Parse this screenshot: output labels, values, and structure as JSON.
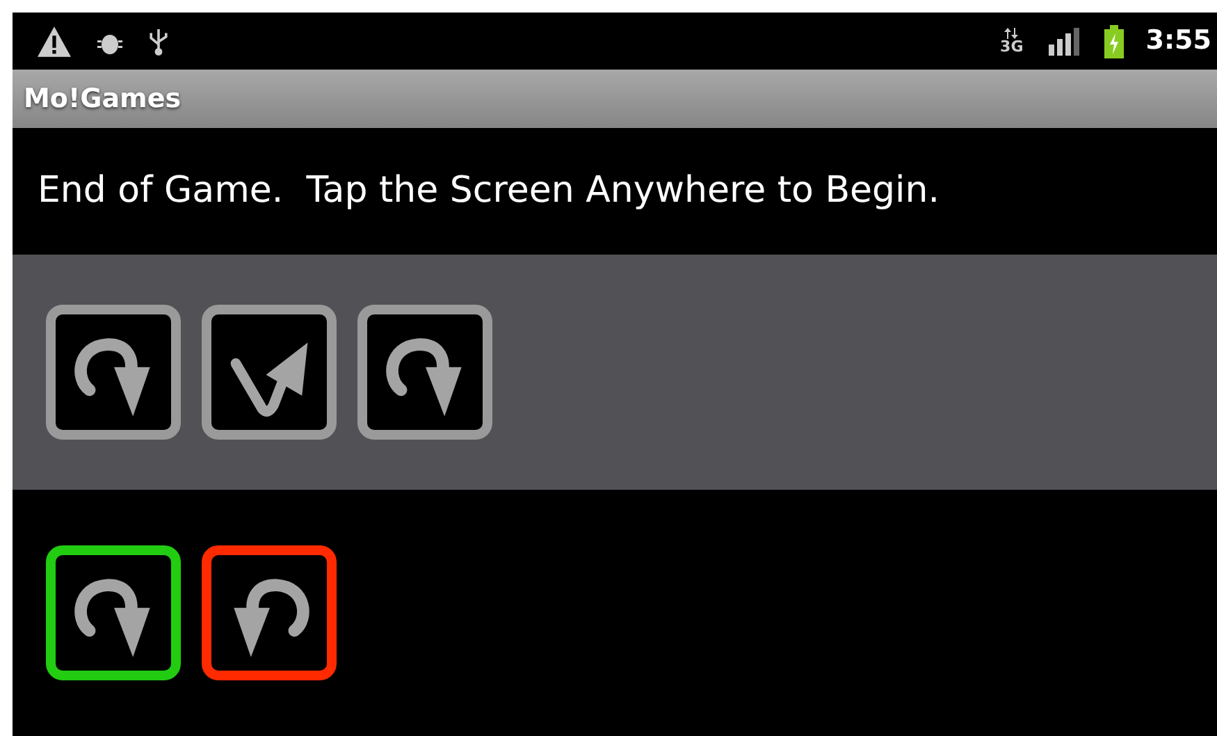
{
  "status_bar": {
    "network_type": "3G",
    "time": "3:55"
  },
  "title_bar": {
    "title": "Mo!Games"
  },
  "message": "End of Game.  Tap the Screen Anywhere to Begin.",
  "sequence": [
    {
      "kind": "curve_right",
      "color": "#9a9a9a"
    },
    {
      "kind": "check",
      "color": "#9a9a9a"
    },
    {
      "kind": "curve_right",
      "color": "#9a9a9a"
    }
  ],
  "choices": [
    {
      "kind": "curve_right",
      "color": "#22cc11"
    },
    {
      "kind": "curve_left",
      "color": "#ff2a00"
    }
  ]
}
